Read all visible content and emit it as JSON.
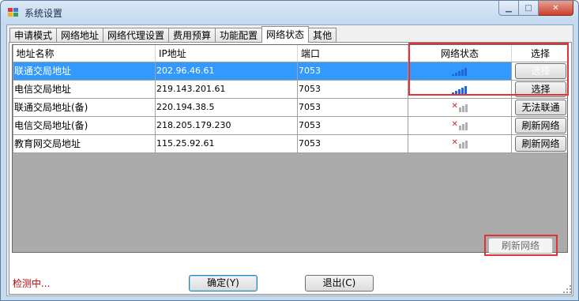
{
  "window": {
    "title": "系统设置",
    "min_icon": "minimize-icon",
    "max_icon": "maximize-icon",
    "close_icon": "close-icon"
  },
  "tabs": [
    {
      "label": "申请模式",
      "active": false
    },
    {
      "label": "网络地址",
      "active": false
    },
    {
      "label": "网络代理设置",
      "active": false
    },
    {
      "label": "费用预算",
      "active": false
    },
    {
      "label": "功能配置",
      "active": false
    },
    {
      "label": "网络状态",
      "active": true
    },
    {
      "label": "其他",
      "active": false
    }
  ],
  "grid": {
    "columns": {
      "name": "地址名称",
      "ip": "IP地址",
      "port": "端口",
      "status": "网络状态",
      "select": "选择"
    },
    "rows": [
      {
        "name": "联通交局地址",
        "ip": "202.96.46.61",
        "port": "7053",
        "signal": "connected-signal-icon",
        "button": "选择",
        "selected": true
      },
      {
        "name": "电信交局地址",
        "ip": "219.143.201.61",
        "port": "7053",
        "signal": "connected-signal-icon",
        "button": "选择",
        "selected": false
      },
      {
        "name": "联通交局地址(备)",
        "ip": "220.194.38.5",
        "port": "7053",
        "signal": "disconnected-signal-icon",
        "button": "无法联通",
        "selected": false
      },
      {
        "name": "电信交局地址(备)",
        "ip": "218.205.179.230",
        "port": "7053",
        "signal": "disconnected-signal-icon",
        "button": "刷新网络",
        "selected": false
      },
      {
        "name": "教育网交局地址",
        "ip": "115.25.92.61",
        "port": "7053",
        "signal": "disconnected-signal-icon",
        "button": "刷新网络",
        "selected": false
      }
    ]
  },
  "refresh_all_label": "刷新网络",
  "status_text": "检测中...",
  "footer": {
    "ok_label": "确定(Y)",
    "exit_label": "退出(C)"
  },
  "colors": {
    "selection": "#3399ff",
    "highlight_box": "#e0343b",
    "status_text": "#c00000",
    "signal_ok": "#1f66d6",
    "signal_bad": "#d22a2a"
  }
}
